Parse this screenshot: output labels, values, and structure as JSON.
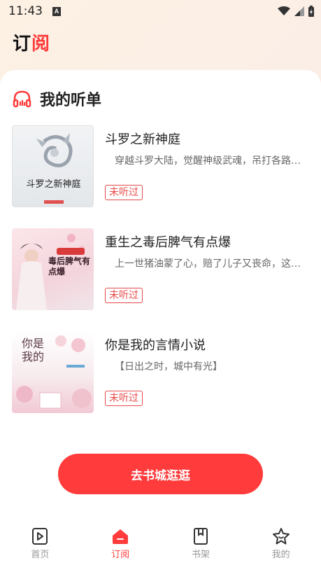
{
  "status_bar": {
    "time": "11:43",
    "icons": [
      "keyboard-a-icon",
      "wifi-icon",
      "cell-signal-icon",
      "battery-icon"
    ]
  },
  "header": {
    "title_part1": "订",
    "title_part2": "阅"
  },
  "section": {
    "title": "我的听单",
    "icon": "headphones-icon"
  },
  "books": [
    {
      "title": "斗罗之新神庭",
      "description": "穿越斗罗大陆，觉醒神级武魂，吊打各路…",
      "badge": "未听过",
      "cover_text": "斗罗之新神庭"
    },
    {
      "title": "重生之毒后脾气有点爆",
      "description": "上一世猪油蒙了心，赔了儿子又丧命，这…",
      "badge": "未听过",
      "cover_text": "毒后脾气有点爆"
    },
    {
      "title": "你是我的言情小说",
      "description": "【日出之时，城中有光】",
      "badge": "未听过",
      "cover_text": "你是我的"
    }
  ],
  "cta": {
    "label": "去书城逛逛"
  },
  "tabs": [
    {
      "label": "首页",
      "icon": "play-icon",
      "active": false
    },
    {
      "label": "订阅",
      "icon": "subscription-icon",
      "active": true
    },
    {
      "label": "书架",
      "icon": "bookmark-icon",
      "active": false
    },
    {
      "label": "我的",
      "icon": "star-face-icon",
      "active": false
    }
  ],
  "colors": {
    "accent": "#ff3b3b",
    "badge": "#e84a4a"
  }
}
